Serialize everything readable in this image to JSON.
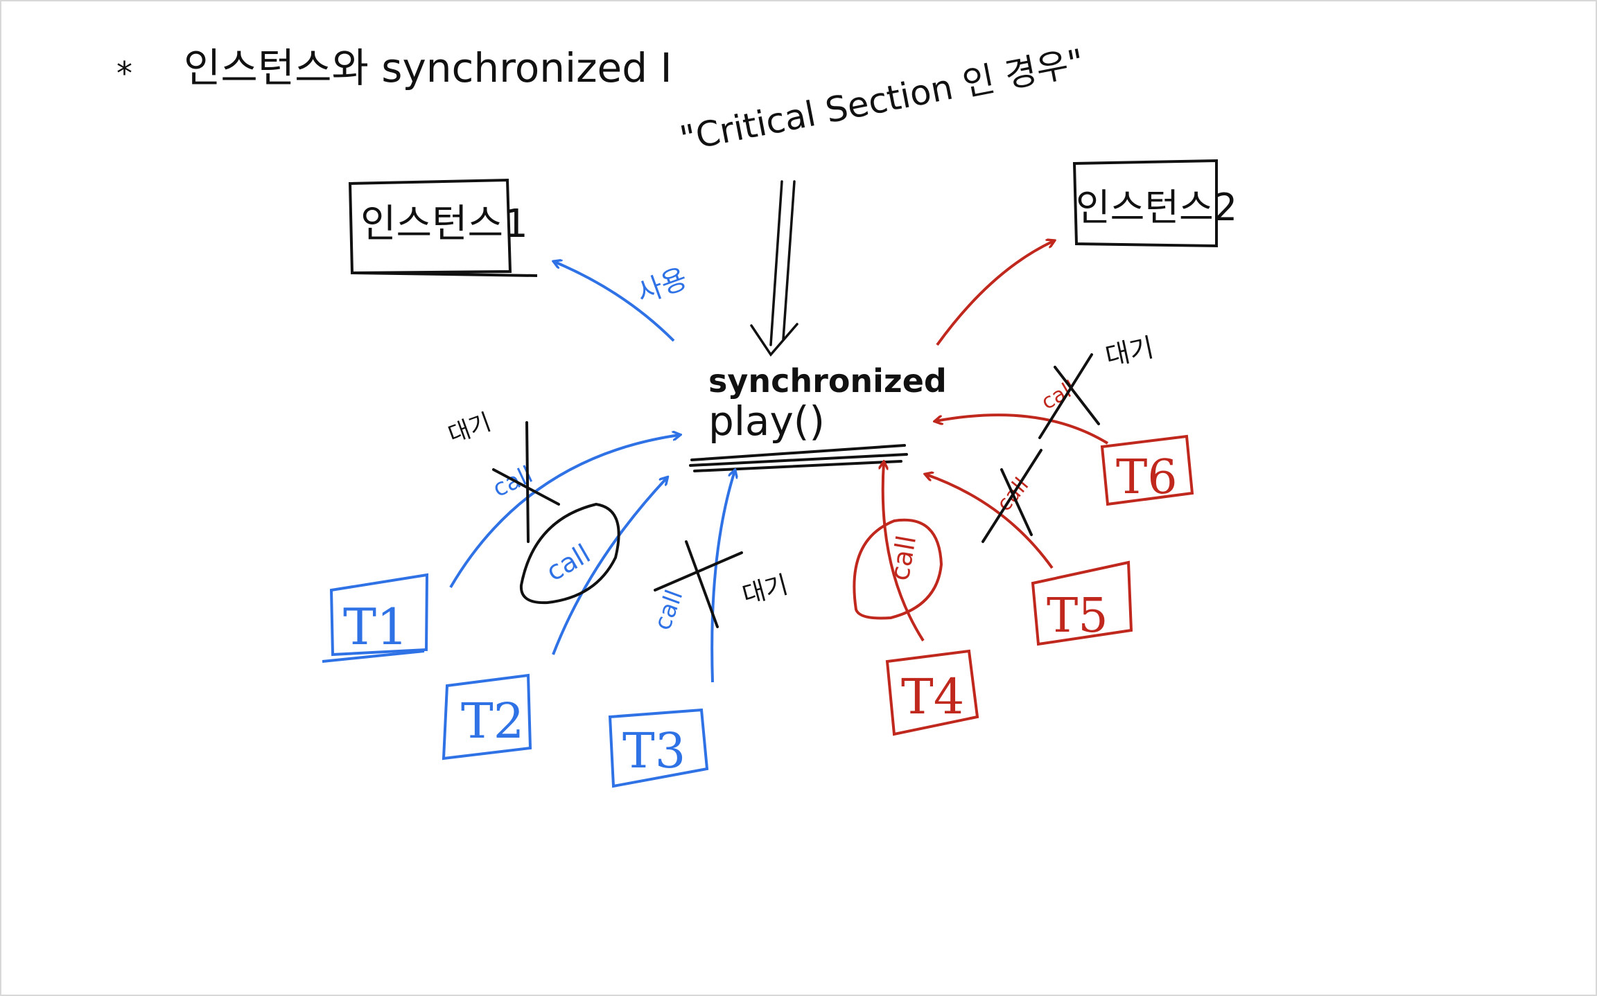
{
  "colors": {
    "ink": "#111111",
    "blue": "#2f72e6",
    "red": "#c0281e",
    "frame": "#d8d8d8"
  },
  "title": {
    "star": "*",
    "text": "인스턴스와 synchronized I"
  },
  "critical_section": "\"Critical Section 인 경우\"",
  "instances": {
    "one": "인스턴스1",
    "two": "인스턴스2"
  },
  "method": {
    "modifier": "synchronized",
    "name": "play()"
  },
  "labels": {
    "use": "사용",
    "call": "call",
    "wait": "대기"
  },
  "threads": {
    "t1": "T1",
    "t2": "T2",
    "t3": "T3",
    "t4": "T4",
    "t5": "T5",
    "t6": "T6"
  }
}
